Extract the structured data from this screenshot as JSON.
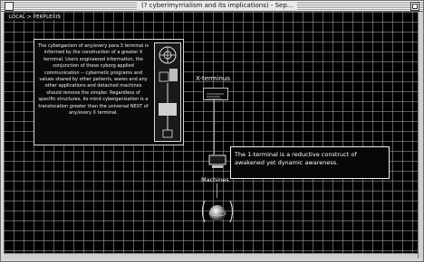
{
  "window": {
    "title": "(? cyberimyrrialism and its implications) - Sep..."
  },
  "nav": {
    "label": "LOCAL > PERPLEXIS"
  },
  "infobox": {
    "text": "The cyberganism of any/every para.3 terminal is informed by the construction of a greater X terminal. Users engineered information, the conjunction of these cyborg applied communication -- cybernetic programs and values shared by other patients, wares and any other applications and detached machines should remove the simpler. Regardless of specific structures, its mind cyberganisation is a translocation greater than the universal NEXT of any/every X terminal."
  },
  "nodes": {
    "xterm_label": "X-terminus",
    "machine_label": "Machines"
  },
  "callout": {
    "text": "The 1-terminal is a reductive construct of awakened yet dynamic awareness."
  },
  "colors": {
    "canvas_bg": "#020202",
    "grid": "#8a8a8a",
    "text": "#ffffff"
  },
  "icons": [
    "close-icon",
    "zoom-icon",
    "schematic-icon",
    "terminal-icon",
    "computer-icon",
    "sphere-icon"
  ]
}
